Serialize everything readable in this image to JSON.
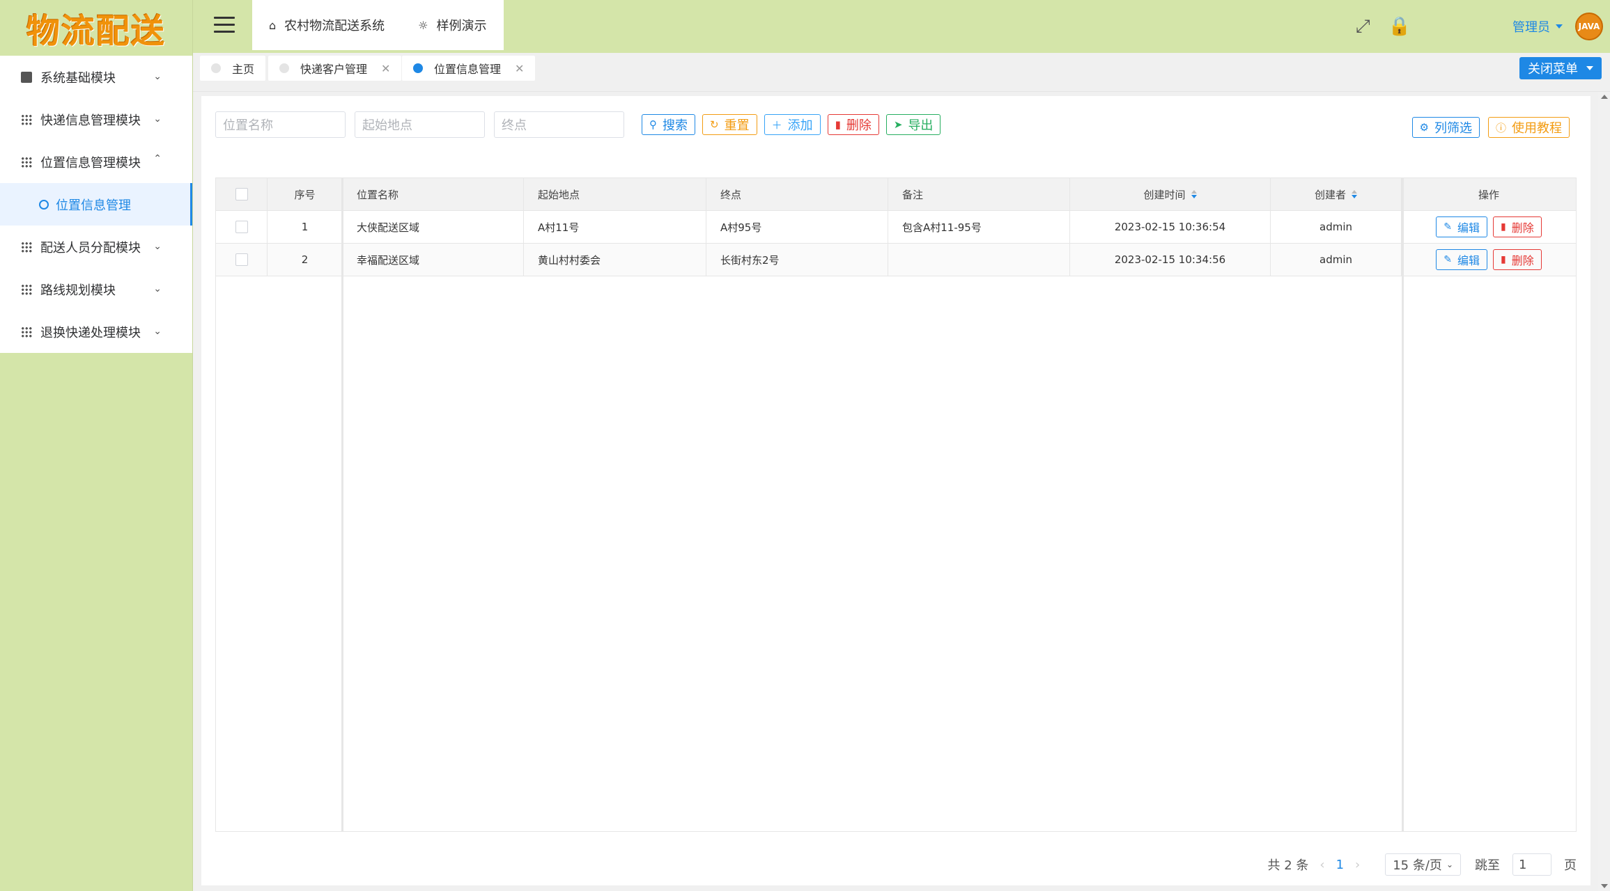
{
  "sidebar": {
    "logo": "物流配送",
    "items": [
      {
        "label": "系统基础模块",
        "expanded": false
      },
      {
        "label": "快递信息管理模块",
        "expanded": false
      },
      {
        "label": "位置信息管理模块",
        "expanded": true
      },
      {
        "label": "位置信息管理",
        "sub": true
      },
      {
        "label": "配送人员分配模块",
        "expanded": false
      },
      {
        "label": "路线规划模块",
        "expanded": false
      },
      {
        "label": "退换快递处理模块",
        "expanded": false
      }
    ]
  },
  "header": {
    "nav": [
      "农村物流配送系统",
      "样例演示"
    ],
    "admin": "管理员",
    "avatar_text": "JAVA"
  },
  "tabs": [
    {
      "label": "主页"
    },
    {
      "label": "快递客户管理"
    },
    {
      "label": "位置信息管理"
    }
  ],
  "close_menu": "关闭菜单",
  "filters": {
    "name_placeholder": "位置名称",
    "start_placeholder": "起始地点",
    "end_placeholder": "终点"
  },
  "toolbar": {
    "search": "搜索",
    "reset": "重置",
    "add": "添加",
    "delete": "删除",
    "export": "导出",
    "columns": "列筛选",
    "tutorial": "使用教程"
  },
  "table": {
    "headers": [
      "序号",
      "位置名称",
      "起始地点",
      "终点",
      "备注",
      "创建时间",
      "创建者",
      "操作"
    ],
    "rows": [
      {
        "no": "1",
        "name": "大侠配送区域",
        "start": "A村11号",
        "end": "A村95号",
        "note": "包含A村11-95号",
        "created": "2023-02-15 10:36:54",
        "creator": "admin"
      },
      {
        "no": "2",
        "name": "幸福配送区域",
        "start": "黄山村村委会",
        "end": "长街村东2号",
        "note": "",
        "created": "2023-02-15 10:34:56",
        "creator": "admin"
      }
    ],
    "edit": "编辑",
    "del": "删除"
  },
  "pager": {
    "total": "共 2 条",
    "current": "1",
    "size": "15 条/页",
    "jump_label": "跳至",
    "jump_value": "1",
    "page_label": "页"
  }
}
